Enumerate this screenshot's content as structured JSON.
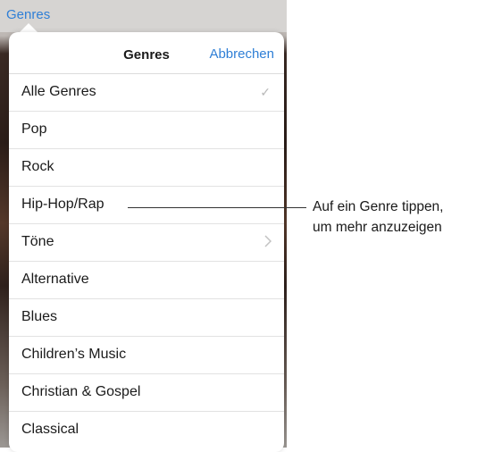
{
  "top_bar": {
    "genres_link": "Genres"
  },
  "popover": {
    "title": "Genres",
    "cancel_label": "Abbrechen",
    "items": [
      {
        "label": "Alle Genres",
        "checked": true
      },
      {
        "label": "Pop"
      },
      {
        "label": "Rock"
      },
      {
        "label": "Hip-Hop/Rap"
      },
      {
        "label": "Töne",
        "has_submenu": true
      },
      {
        "label": "Alternative"
      },
      {
        "label": "Blues"
      },
      {
        "label": "Children’s Music"
      },
      {
        "label": "Christian & Gospel"
      },
      {
        "label": "Classical"
      }
    ]
  },
  "annotation": {
    "line1": "Auf ein Genre tippen,",
    "line2": "um mehr anzuzeigen"
  },
  "colors": {
    "accent": "#2f7fd6",
    "separator": "#e2e2e2"
  }
}
